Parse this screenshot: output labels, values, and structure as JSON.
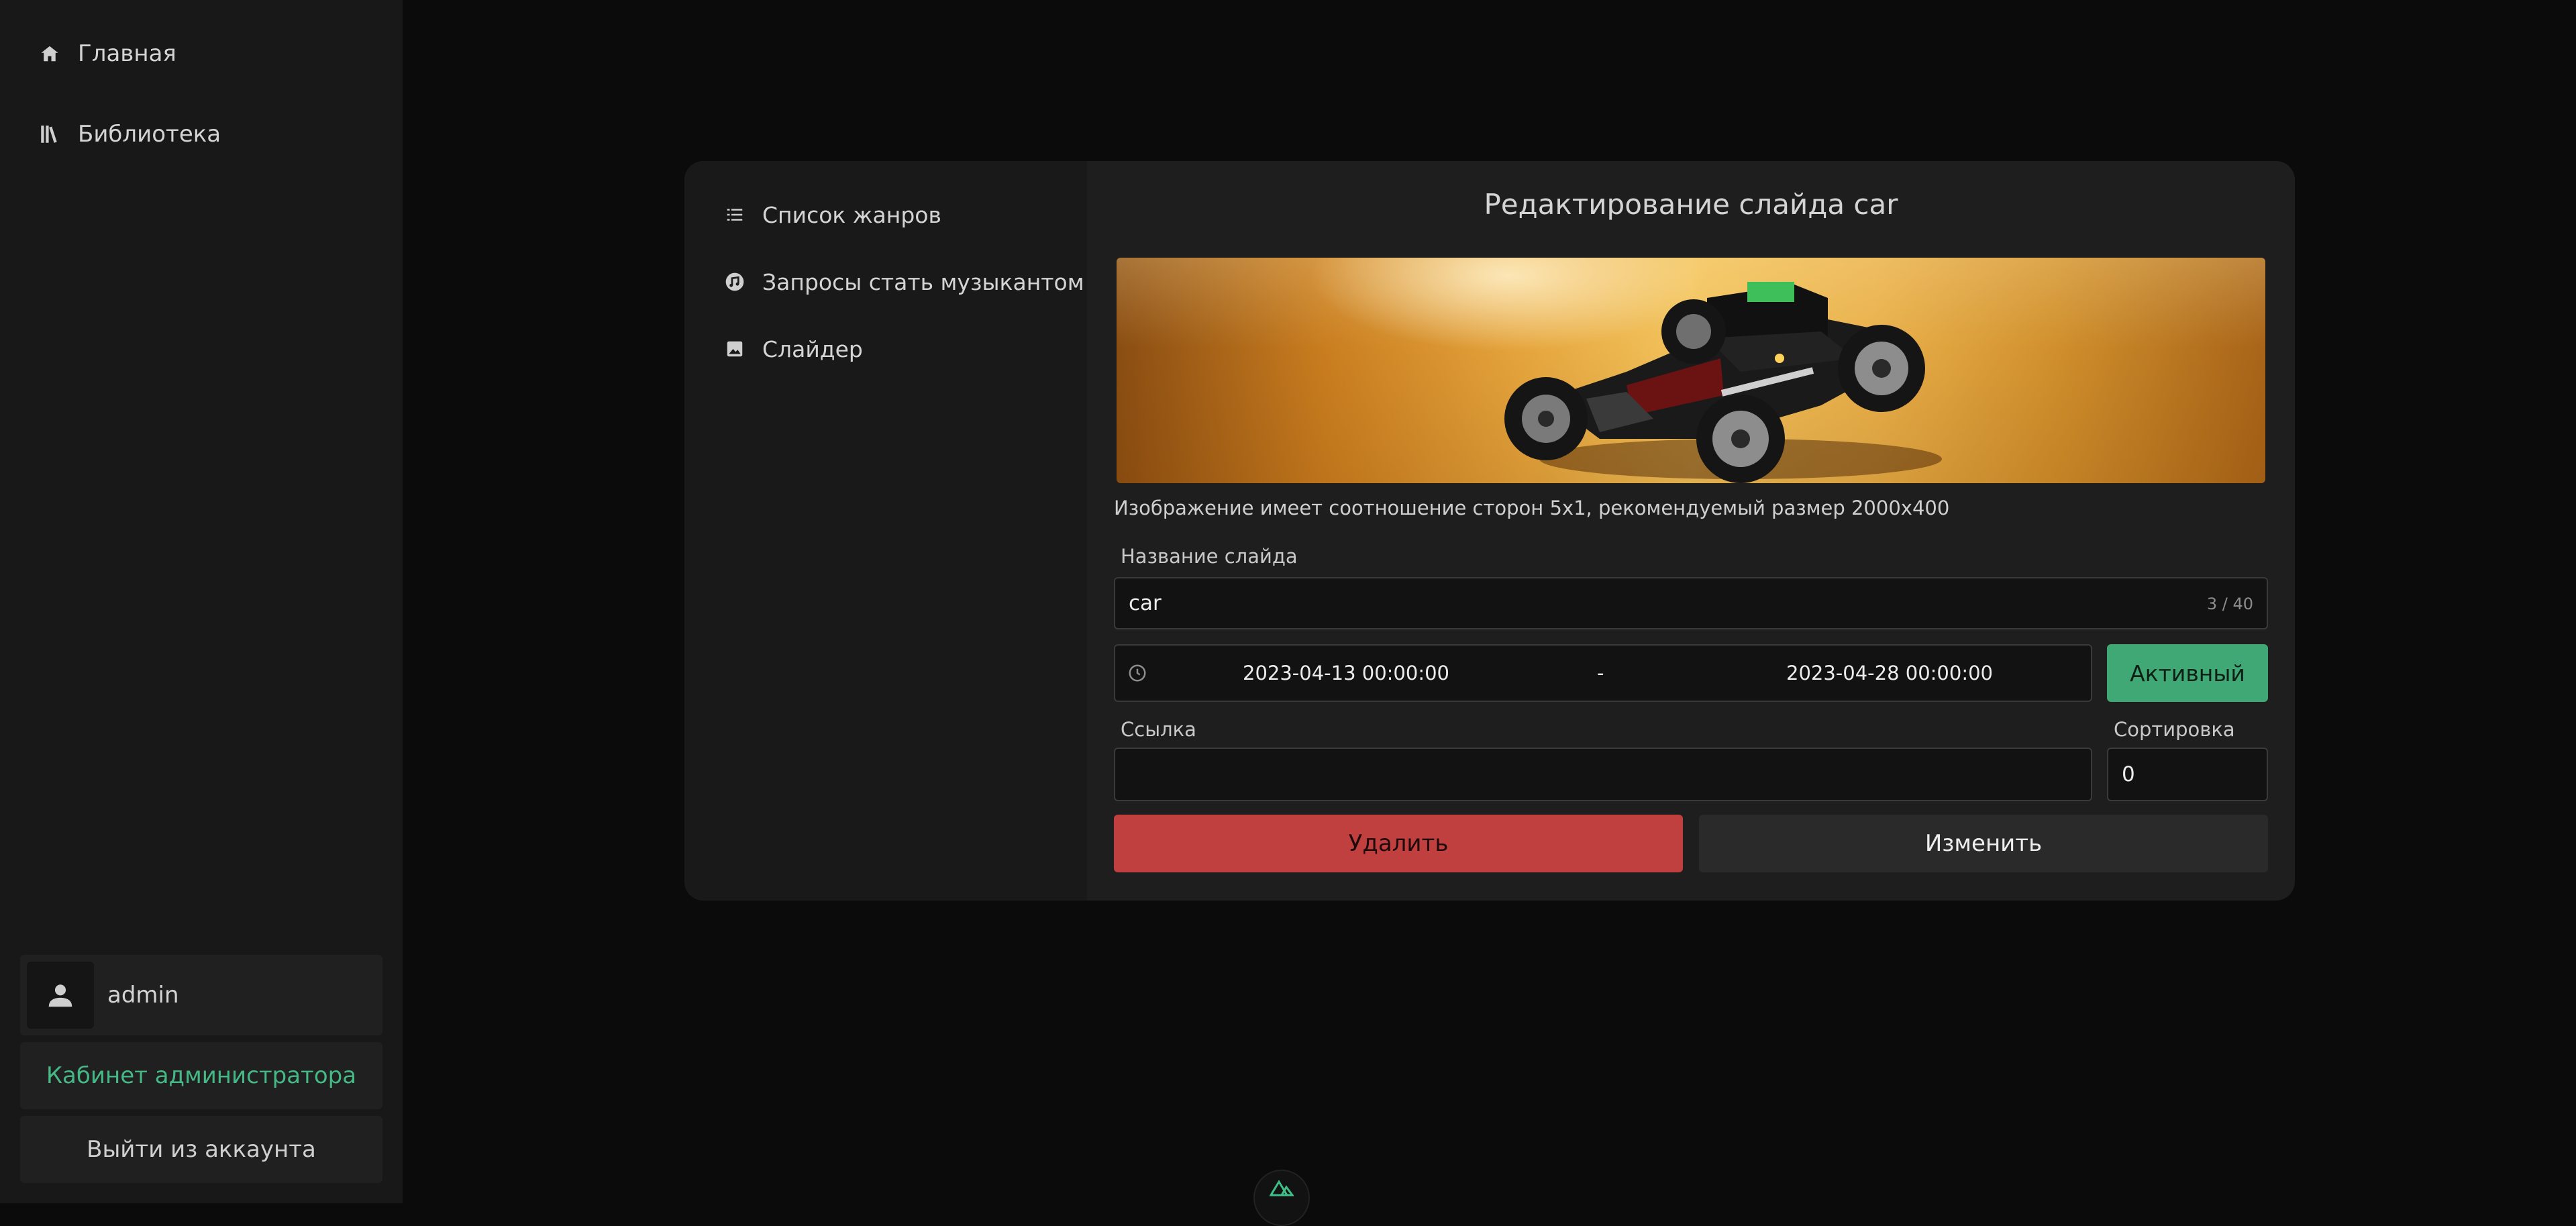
{
  "sidebar": {
    "items": [
      {
        "label": "Главная",
        "icon": "home-icon"
      },
      {
        "label": "Библиотека",
        "icon": "library-icon"
      }
    ],
    "user": {
      "name": "admin",
      "icon": "user-icon"
    },
    "admin_button": "Кабинет администратора",
    "logout_button": "Выйти из аккаунта"
  },
  "admin_menu": {
    "items": [
      {
        "label": "Список жанров",
        "icon": "list-icon"
      },
      {
        "label": "Запросы стать музыкантом",
        "icon": "music-request-icon"
      },
      {
        "label": "Слайдер",
        "icon": "image-icon"
      }
    ]
  },
  "editor": {
    "title": "Редактирование слайда car",
    "image_hint": "Изображение имеет соотношение сторон 5x1, рекомендуемый размер 2000x400",
    "name_label": "Название слайда",
    "name_value": "car",
    "name_counter": "3 / 40",
    "date_start": "2023-04-13 00:00:00",
    "date_separator": "-",
    "date_end": "2023-04-28 00:00:00",
    "active_button": "Активный",
    "link_label": "Ссылка",
    "link_value": "",
    "sort_label": "Сортировка",
    "sort_value": "0",
    "delete_button": "Удалить",
    "change_button": "Изменить"
  },
  "colors": {
    "accent_green": "#45b886",
    "active_green": "#3fa874",
    "delete_red": "#c04040",
    "background": "#0b0b0b"
  }
}
